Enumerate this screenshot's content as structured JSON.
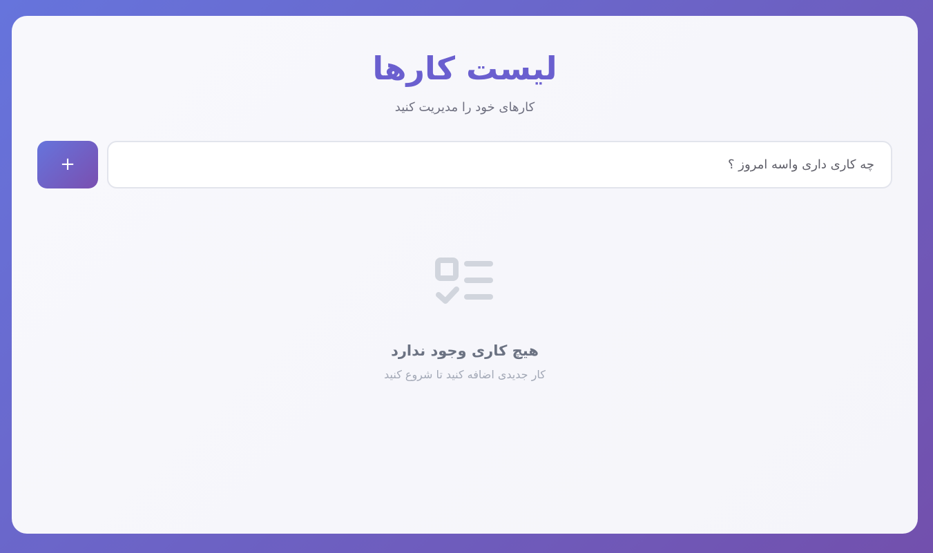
{
  "app": {
    "title": "لیست کارها",
    "subtitle": "کارهای خود را مدیریت کنید"
  },
  "input": {
    "placeholder": "چه کاری داری واسه امروز ؟",
    "value": ""
  },
  "add_button": {
    "label": "+"
  },
  "empty_state": {
    "icon": "checklist-icon",
    "title": "هیچ کاری وجود ندارد",
    "subtitle": "کار جدیدی اضافه کنید تا شروع کنید"
  },
  "colors": {
    "accent": "#6a5fcf",
    "gradient_start": "#6674dc",
    "gradient_end": "#7250ad",
    "icon_gray": "#d1d5dd"
  }
}
